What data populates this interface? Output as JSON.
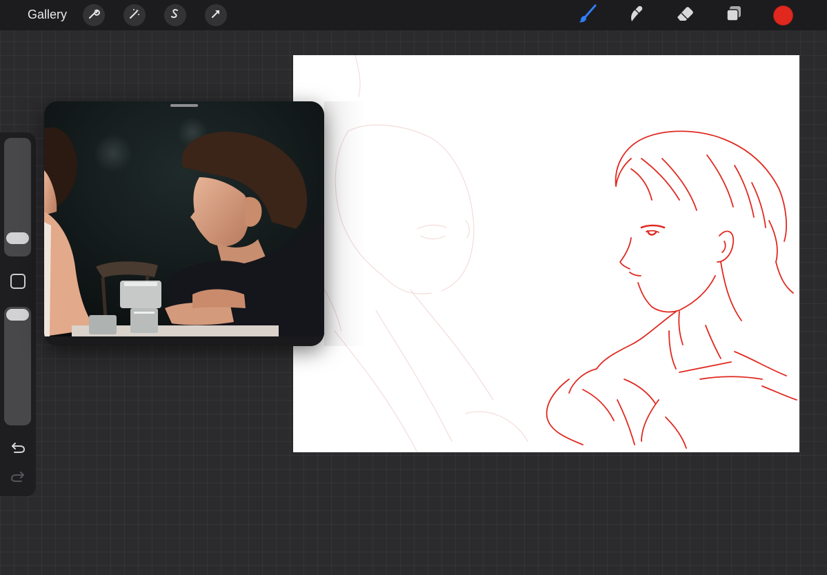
{
  "toolbar": {
    "gallery_label": "Gallery",
    "left_tools": [
      "wrench-icon",
      "magic-wand-icon",
      "selection-icon",
      "transform-arrow-icon"
    ],
    "right_tools": [
      "brush-icon",
      "smudge-icon",
      "eraser-icon",
      "layers-icon"
    ],
    "active_tool": "brush-icon",
    "active_tool_color": "#2f7cf6",
    "current_color": "#e0281f"
  },
  "sidebar": {
    "brush_size_level": 0.1,
    "opacity_level": 1.0,
    "controls": [
      "brush-size-slider",
      "modify-button",
      "opacity-slider",
      "undo-icon",
      "redo-icon"
    ]
  },
  "canvas": {
    "background": "#ffffff",
    "stroke_color": "#e0281f",
    "sketch_color_faint": "#f3d8d6"
  },
  "reference": {
    "icon": "reference-photo"
  }
}
